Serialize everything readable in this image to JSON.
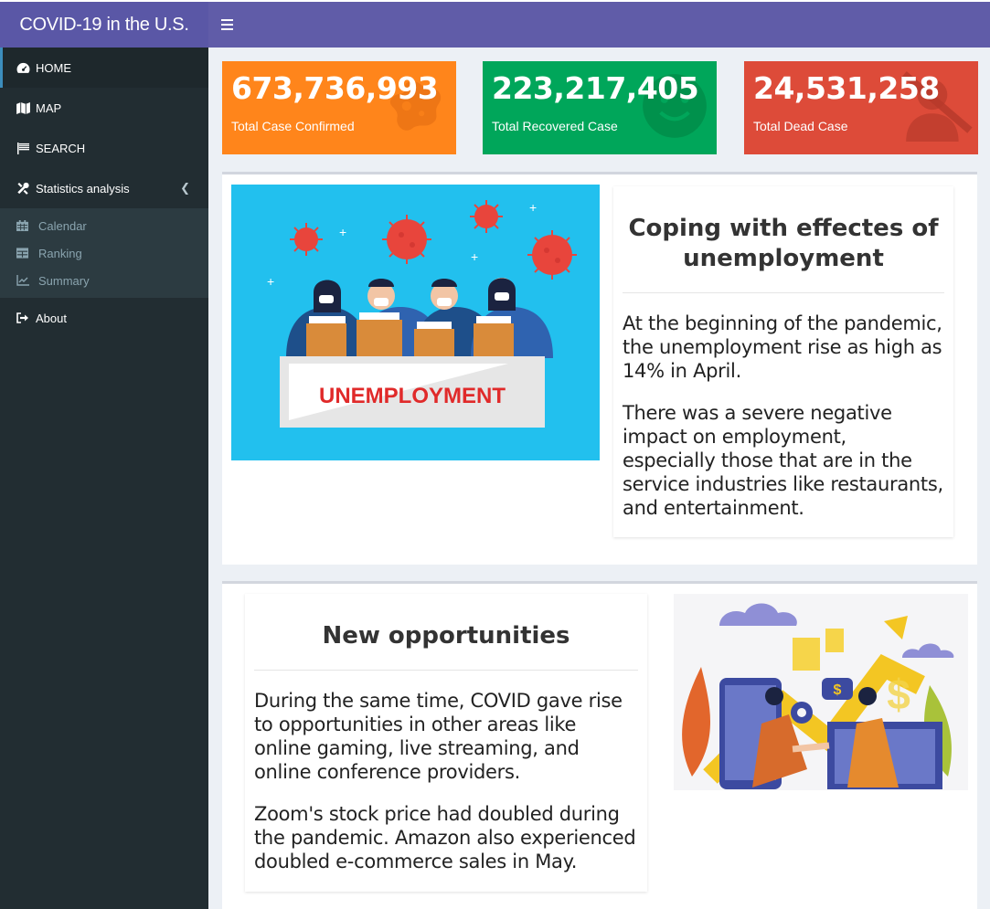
{
  "app": {
    "title": "COVID-19 in the U.S."
  },
  "sidebar": {
    "items": [
      {
        "label": "HOME",
        "icon": "dashboard-icon"
      },
      {
        "label": "MAP",
        "icon": "map-icon"
      },
      {
        "label": "SEARCH",
        "icon": "flag-icon"
      },
      {
        "label": "Statistics analysis",
        "icon": "tools-icon"
      }
    ],
    "submenu": [
      {
        "label": "Calendar",
        "icon": "calendar-icon"
      },
      {
        "label": "Ranking",
        "icon": "table-icon"
      },
      {
        "label": "Summary",
        "icon": "line-chart-icon"
      }
    ],
    "about": {
      "label": "About",
      "icon": "sign-out-icon"
    }
  },
  "stats": [
    {
      "value": "673,736,993",
      "label": "Total Case Confirmed",
      "color": "#ff851b",
      "icon": "virus-icon"
    },
    {
      "value": "223,217,405",
      "label": "Total Recovered Case",
      "color": "#00a65a",
      "icon": "smile-icon"
    },
    {
      "value": "24,531,258",
      "label": "Total Dead Case",
      "color": "#dd4b39",
      "icon": "user-slash-icon"
    }
  ],
  "section1": {
    "image_text": "UNEMPLOYMENT",
    "title": "Coping with effectes of unemployment",
    "p1": "At the beginning of the pandemic, the unemployment rise as high as 14% in April.",
    "p2": "There was a severe negative impact on employment, especially those that are in the service industries like restaurants, and entertainment."
  },
  "section2": {
    "title": "New opportunities",
    "p1": "During the same time, COVID gave rise to opportunities in other areas like online gaming, live streaming, and online conference providers.",
    "p2": "Zoom's stock price had doubled during the pandemic. Amazon also experienced doubled e-commerce sales in May."
  },
  "colors": {
    "header": "#605ca8",
    "brand": "#5a57a6",
    "sidebar": "#222d32"
  }
}
